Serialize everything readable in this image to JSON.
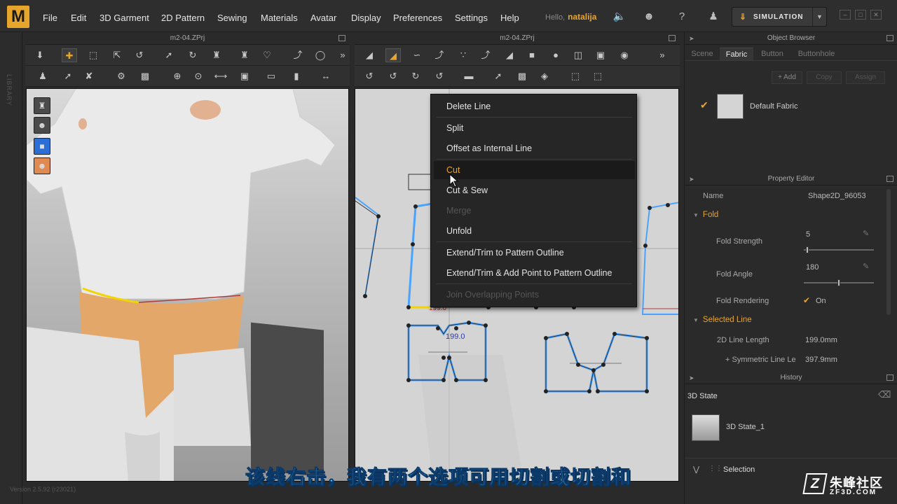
{
  "app": {
    "logo": "M"
  },
  "menu": {
    "items": [
      "File",
      "Edit",
      "3D Garment",
      "2D Pattern",
      "Sewing",
      "Materials",
      "Avatar",
      "Display",
      "Preferences",
      "Settings",
      "Help"
    ],
    "hello": "Hello,",
    "username": "natalija"
  },
  "simulation": {
    "label": "SIMULATION"
  },
  "library_label": "LIBRARY",
  "version": "Version 2.5.92     (r23021)",
  "view3d": {
    "title": "m2-04.ZPrj"
  },
  "view2d": {
    "title": "m2-04.ZPrj",
    "measure_label": "199.0",
    "measure_label2": "199.0"
  },
  "context_menu": {
    "items": [
      {
        "label": "Delete Line",
        "state": "normal"
      },
      {
        "label": "Split",
        "state": "normal"
      },
      {
        "label": "Offset as Internal Line",
        "state": "normal"
      },
      {
        "label": "Cut",
        "state": "highlight"
      },
      {
        "label": "Cut & Sew",
        "state": "normal"
      },
      {
        "label": "Merge",
        "state": "disabled"
      },
      {
        "label": "Unfold",
        "state": "normal"
      },
      {
        "label": "Extend/Trim to Pattern Outline",
        "state": "normal"
      },
      {
        "label": "Extend/Trim & Add Point to Pattern Outline",
        "state": "normal"
      },
      {
        "label": "Join Overlapping Points",
        "state": "disabled"
      }
    ]
  },
  "object_browser": {
    "title": "Object Browser",
    "tabs": [
      "Scene",
      "Fabric",
      "Button",
      "Buttonhole"
    ],
    "active_tab": "Fabric",
    "buttons": [
      "+ Add",
      "Copy",
      "Assign"
    ],
    "fabric_name": "Default Fabric"
  },
  "property_editor": {
    "title": "Property Editor",
    "name_label": "Name",
    "name_value": "Shape2D_96053",
    "fold_section": "Fold",
    "fold_strength_label": "Fold Strength",
    "fold_strength_value": "5",
    "fold_strength_level": 0.05,
    "fold_angle_label": "Fold Angle",
    "fold_angle_value": "180",
    "fold_angle_level": 0.5,
    "fold_rendering_label": "Fold Rendering",
    "fold_rendering_value": "On",
    "selected_line_section": "Selected Line",
    "line_length_label": "2D Line Length",
    "line_length_value": "199.0mm",
    "symmetric_label": "+ Symmetric Line Le",
    "symmetric_value": "397.9mm"
  },
  "history": {
    "title": "History",
    "section": "3D State",
    "item": "3D State_1",
    "selection_label": "Selection"
  },
  "subtitle": "该线右击，我有两个选项可用切割或切割和",
  "watermark": {
    "logo": "Z",
    "line1": "朱峰社区",
    "line2": "ZF3D.COM"
  },
  "colors": {
    "accent": "#e8a52c",
    "selection_blue": "#4aa3ff",
    "subtitle": "#5ad6ff"
  }
}
